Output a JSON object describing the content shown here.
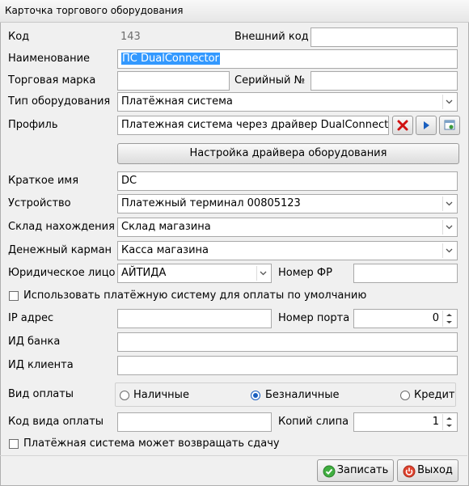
{
  "window": {
    "title": "Карточка торгового оборудования"
  },
  "fields": {
    "code_label": "Код",
    "code_value": "143",
    "ext_code_label": "Внешний код",
    "ext_code_value": "",
    "name_label": "Наименование",
    "name_value": "ПС DualConnector",
    "brand_label": "Торговая марка",
    "brand_value": "",
    "serial_label": "Серийный №",
    "serial_value": "",
    "type_label": "Тип оборудования",
    "type_value": "Платёжная система",
    "profile_label": "Профиль",
    "profile_value": "Платежная система через драйвер DualConnector",
    "driver_settings_button": "Настройка драйвера оборудования",
    "short_name_label": "Краткое имя",
    "short_name_value": "DC",
    "device_label": "Устройство",
    "device_value": "Платежный терминал 00805123",
    "warehouse_label": "Склад нахождения",
    "warehouse_value": "Склад магазина",
    "cash_pocket_label": "Денежный карман",
    "cash_pocket_value": "Касса магазина",
    "legal_entity_label": "Юридическое лицо",
    "legal_entity_value": "АЙТИДА",
    "fr_number_label": "Номер ФР",
    "fr_number_value": "",
    "default_payment_label": "Использовать платёжную систему для оплаты по умолчанию",
    "ip_label": "IP адрес",
    "ip_value": "",
    "port_label": "Номер порта",
    "port_value": "0",
    "bank_id_label": "ИД банка",
    "bank_id_value": "",
    "client_id_label": "ИД клиента",
    "client_id_value": "",
    "payment_type_label": "Вид оплаты",
    "payment_options": [
      "Наличные",
      "Безналичные",
      "Кредит"
    ],
    "payment_selected": "Безналичные",
    "payment_code_label": "Код вида оплаты",
    "payment_code_value": "",
    "slip_copies_label": "Копий слипа",
    "slip_copies_value": "1",
    "return_change_label": "Платёжная система может возвращать сдачу"
  },
  "buttons": {
    "save": "Записать",
    "exit": "Выход"
  },
  "icons": {
    "profile_clear": "red-x-icon",
    "profile_select": "blue-play-icon",
    "profile_open": "open-card-icon",
    "save": "green-check-icon",
    "exit": "red-power-icon"
  },
  "colors": {
    "selection": "#3399ff",
    "radio_selected": "#1a5fbf"
  }
}
